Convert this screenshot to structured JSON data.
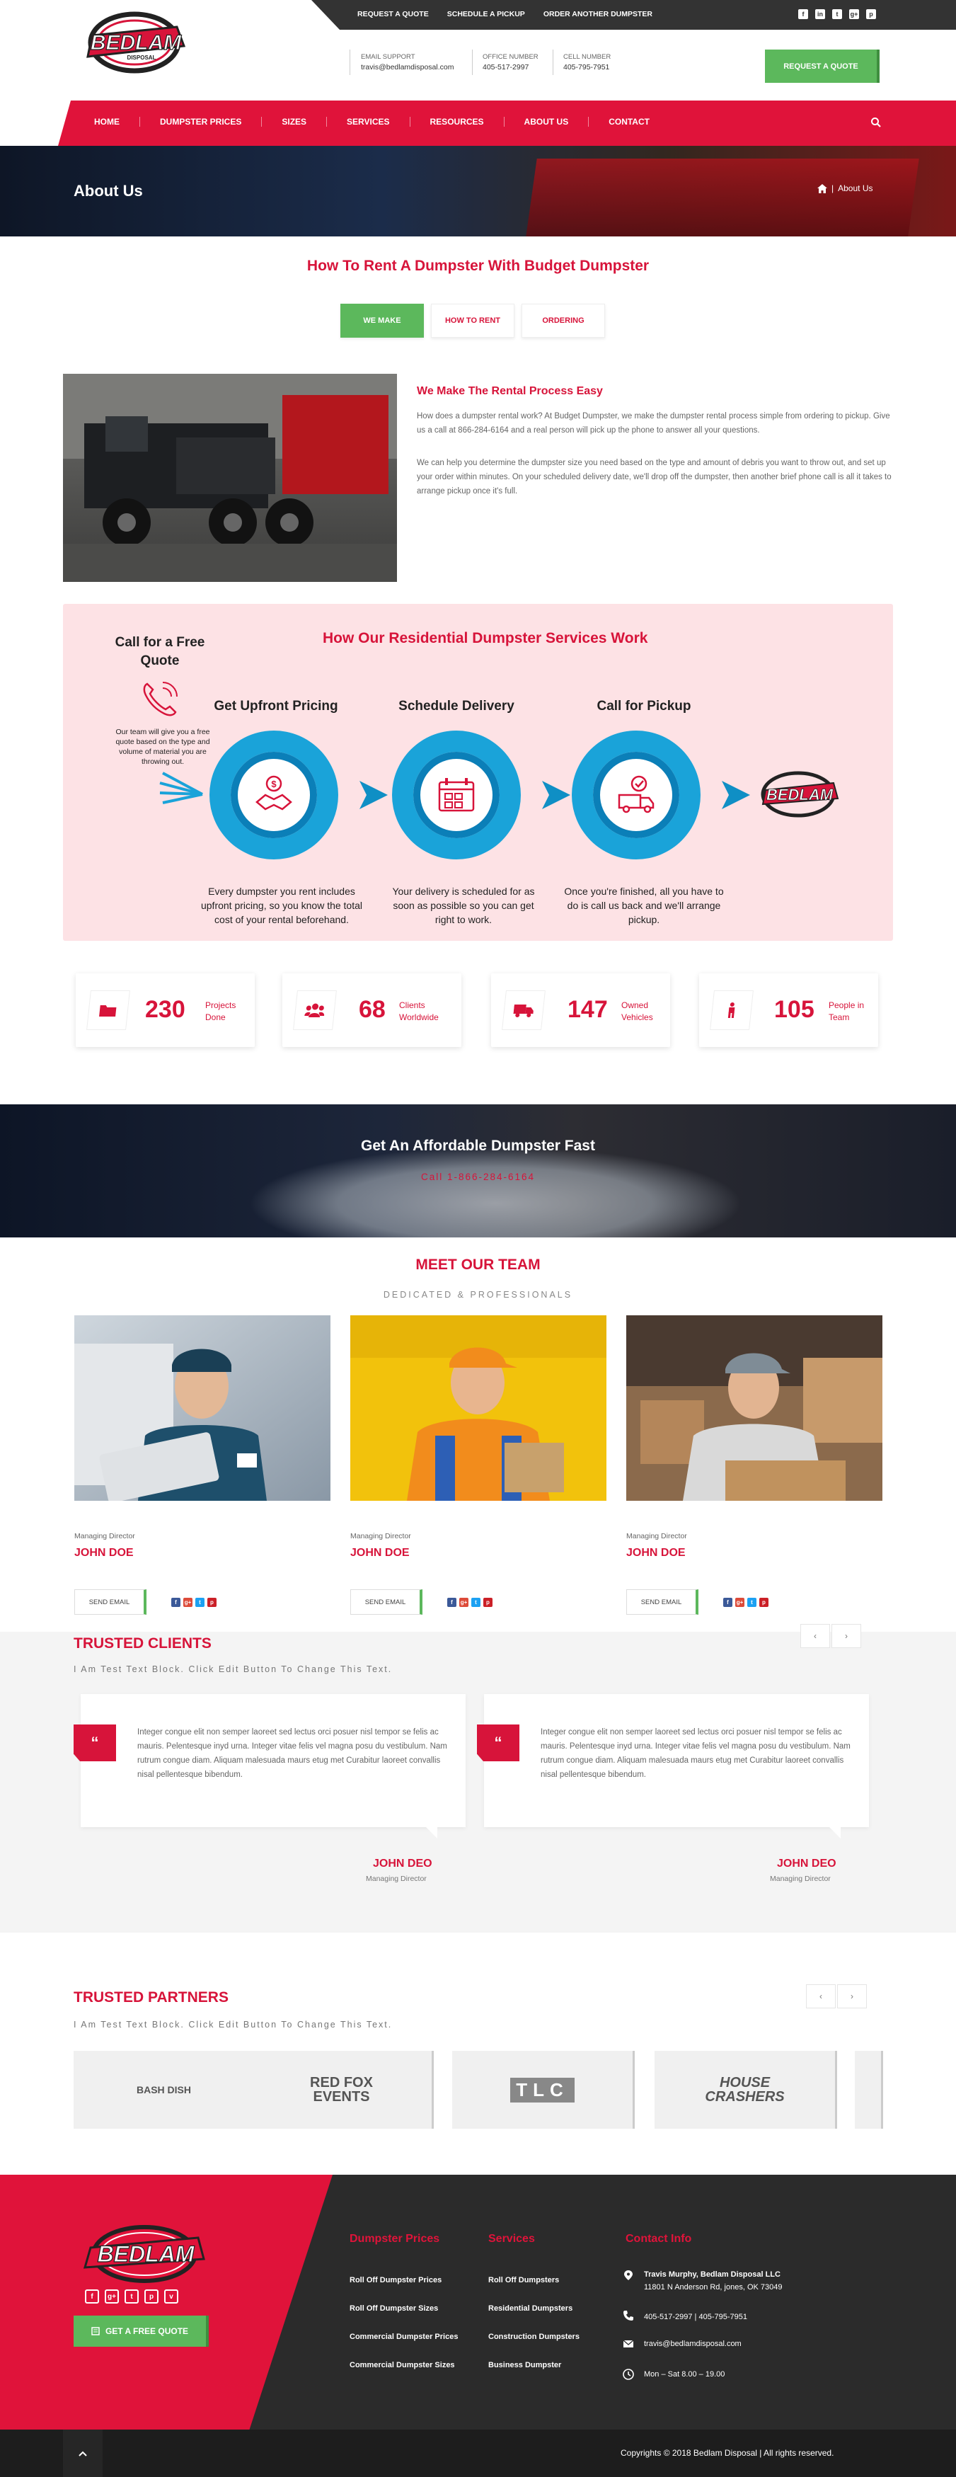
{
  "topbar": {
    "links": [
      "REQUEST A QUOTE",
      "SCHEDULE A PICKUP",
      "ORDER ANOTHER DUMPSTER"
    ],
    "social": [
      "f",
      "in",
      "t",
      "g+",
      "p"
    ]
  },
  "brand": {
    "logo_text": "BEDLAM",
    "logo_sub": "DISPOSAL"
  },
  "header": {
    "email_label": "EMAIL SUPPORT",
    "email_value": "travis@bedlamdisposal.com",
    "office_label": "OFFICE NUMBER",
    "office_value": "405-517-2997",
    "cell_label": "CELL NUMBER",
    "cell_value": "405-795-7951",
    "quote_button": "REQUEST A QUOTE"
  },
  "nav": {
    "items": [
      "HOME",
      "DUMPSTER PRICES",
      "SIZES",
      "SERVICES",
      "RESOURCES",
      "ABOUT US",
      "CONTACT"
    ]
  },
  "hero": {
    "title": "About Us",
    "breadcrumb": "About Us"
  },
  "rent": {
    "title": "How To Rent A Dumpster With Budget Dumpster",
    "tabs": [
      "WE MAKE",
      "HOW TO RENT",
      "ORDERING"
    ],
    "heading": "We Make The Rental Process Easy",
    "p1": "How does a dumpster rental work? At Budget Dumpster, we make the dumpster rental process simple from ordering to pickup. Give us a call at 866-284-6164 and a real person will pick up the phone to answer all your questions.",
    "p2": "We can help you determine the dumpster size you need based on the type and amount of debris you want to throw out, and set up your order within minutes. On your scheduled delivery date, we'll drop off the dumpster, then another brief phone call is all it takes to arrange pickup once it's full."
  },
  "process": {
    "title": "How Our Residential Dumpster Services Work",
    "call_title": "Call for a Free Quote",
    "call_text": "Our team will give you a free quote based on the type and volume of material you are throwing out.",
    "steps": [
      {
        "title": "Get Upfront Pricing",
        "text": "Every dumpster you rent includes upfront pricing, so you know the total cost of your rental beforehand."
      },
      {
        "title": "Schedule Delivery",
        "text": "Your delivery is scheduled for as soon as possible so you can get right to work."
      },
      {
        "title": "Call for Pickup",
        "text": "Once you're finished, all you have to do is call us back and we'll arrange pickup."
      }
    ]
  },
  "stats": [
    {
      "num": "230",
      "label1": "Projects",
      "label2": "Done"
    },
    {
      "num": "68",
      "label1": "Clients",
      "label2": "Worldwide"
    },
    {
      "num": "147",
      "label1": "Owned",
      "label2": "Vehicles"
    },
    {
      "num": "105",
      "label1": "People in",
      "label2": "Team"
    }
  ],
  "cta": {
    "title": "Get An Affordable Dumpster Fast",
    "text": "Call 1-866-284-6164"
  },
  "team": {
    "title": "MEET OUR TEAM",
    "subtitle": "DEDICATED & PROFESSIONALS",
    "members": [
      {
        "role": "Managing Director",
        "name": "JOHN DOE",
        "button": "SEND EMAIL"
      },
      {
        "role": "Managing Director",
        "name": "JOHN DOE",
        "button": "SEND EMAIL"
      },
      {
        "role": "Managing Director",
        "name": "JOHN DOE",
        "button": "SEND EMAIL"
      }
    ]
  },
  "clients": {
    "title": "TRUSTED CLIENTS",
    "subtitle": "I Am Test Text Block. Click Edit Button To Change This Text.",
    "pager": [
      "‹",
      "›"
    ],
    "testimonials": [
      {
        "text": "Integer congue elit non semper laoreet sed lectus orci posuer nisl tempor se felis ac mauris. Pelentesque inyd urna. Integer vitae felis vel magna posu du vestibulum. Nam rutrum congue diam. Aliquam malesuada maurs etug met Curabitur laoreet convallis nisal pellentesque bibendum.",
        "name": "JOHN DEO",
        "role": "Managing Director"
      },
      {
        "text": "Integer congue elit non semper laoreet sed lectus orci posuer nisl tempor se felis ac mauris. Pelentesque inyd urna. Integer vitae felis vel magna posu du vestibulum. Nam rutrum congue diam. Aliquam malesuada maurs etug met Curabitur laoreet convallis nisal pellentesque bibendum.",
        "name": "JOHN DEO",
        "role": "Managing Director"
      }
    ]
  },
  "partners": {
    "title": "TRUSTED PARTNERS",
    "subtitle": "I Am Test Text Block. Click Edit Button To Change This Text.",
    "pager": [
      "‹",
      "›"
    ],
    "logos": [
      "BASH DISH",
      "RED FOX EVENTS",
      "TLC",
      "HOUSE CRASHERS"
    ]
  },
  "footer": {
    "social": [
      "f",
      "g+",
      "t",
      "p",
      "v"
    ],
    "quote_button": "GET A FREE QUOTE",
    "prices_title": "Dumpster Prices",
    "prices_links": [
      "Roll Off Dumpster Prices",
      "Roll Off Dumpster Sizes",
      "Commercial Dumpster Prices",
      "Commercial Dumpster Sizes"
    ],
    "services_title": "Services",
    "services_links": [
      "Roll Off Dumpsters",
      "Residential Dumpsters",
      "Construction Dumpsters",
      "Business Dumpster"
    ],
    "contact_title": "Contact Info",
    "contact_name": "Travis Murphy, Bedlam Disposal LLC",
    "contact_address": "11801 N Anderson Rd, jones, OK 73049",
    "contact_phone": "405-517-2997 | 405-795-7951",
    "contact_email": "travis@bedlamdisposal.com",
    "contact_hours": "Mon – Sat 8.00 – 19.00",
    "copyright": "Copyrights © 2018 Bedlam Disposal | All rights reserved."
  },
  "colors": {
    "brand_red": "#e0133a",
    "green": "#5cb85c",
    "dark": "#2b2b2b",
    "blue": "#0f8fc5"
  }
}
